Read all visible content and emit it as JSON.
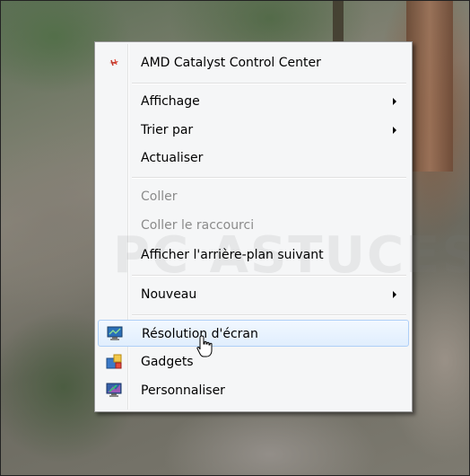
{
  "context_menu": {
    "items": [
      {
        "label": "AMD Catalyst Control Center",
        "icon": "amd-catalyst-icon",
        "enabled": true
      },
      {
        "label": "Affichage",
        "submenu": true,
        "enabled": true
      },
      {
        "label": "Trier par",
        "submenu": true,
        "enabled": true
      },
      {
        "label": "Actualiser",
        "enabled": true
      },
      {
        "label": "Coller",
        "enabled": false
      },
      {
        "label": "Coller le raccourci",
        "enabled": false
      },
      {
        "label": "Afficher l'arrière-plan suivant",
        "enabled": true
      },
      {
        "label": "Nouveau",
        "submenu": true,
        "enabled": true
      },
      {
        "label": "Résolution d'écran",
        "icon": "screen-resolution-icon",
        "enabled": true,
        "highlighted": true
      },
      {
        "label": "Gadgets",
        "icon": "gadgets-icon",
        "enabled": true
      },
      {
        "label": "Personnaliser",
        "icon": "personalize-icon",
        "enabled": true
      }
    ]
  },
  "watermark": {
    "text": "PC ASTUCES"
  },
  "colors": {
    "highlight_border": "#aecff7",
    "menu_background": "#f5f6f7",
    "disabled_text": "#8b8b8b"
  }
}
